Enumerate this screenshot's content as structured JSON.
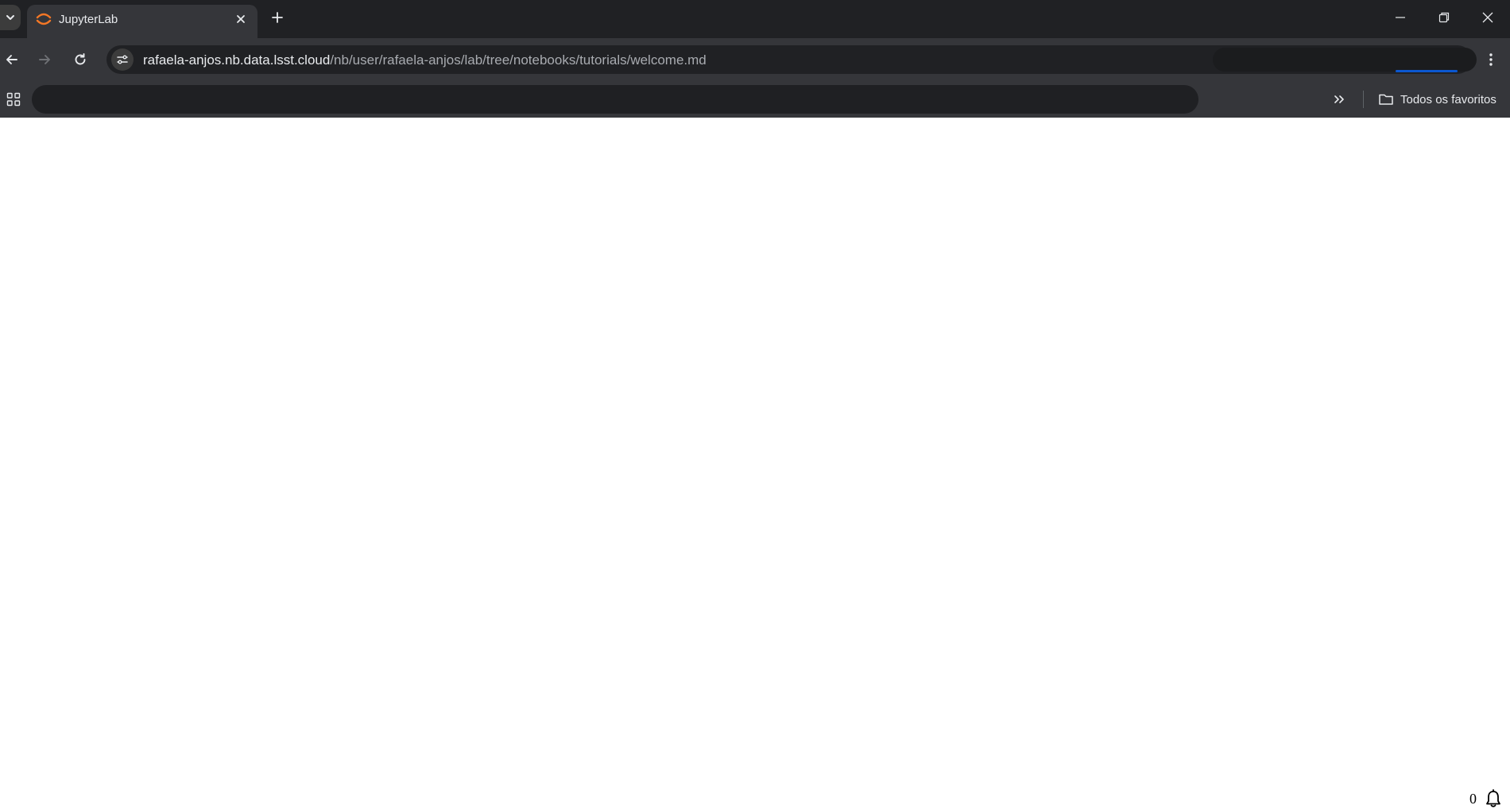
{
  "browser": {
    "tab": {
      "title": "JupyterLab",
      "favicon": "jupyter-icon",
      "favicon_color": "#f37726"
    },
    "address_bar": {
      "url_host": "rafaela-anjos.nb.data.lsst.cloud",
      "url_path": "/nb/user/rafaela-anjos/lab/tree/notebooks/tutorials/welcome.md"
    },
    "bookmarks_bar": {
      "all_bookmarks_label": "Todos os favoritos"
    },
    "colors": {
      "frame": "#202124",
      "toolbar": "#35363a",
      "text": "#e8eaed",
      "accent": "#0b57d0"
    }
  },
  "page": {
    "notifications": {
      "count": "0",
      "icon": "bell-icon"
    }
  }
}
